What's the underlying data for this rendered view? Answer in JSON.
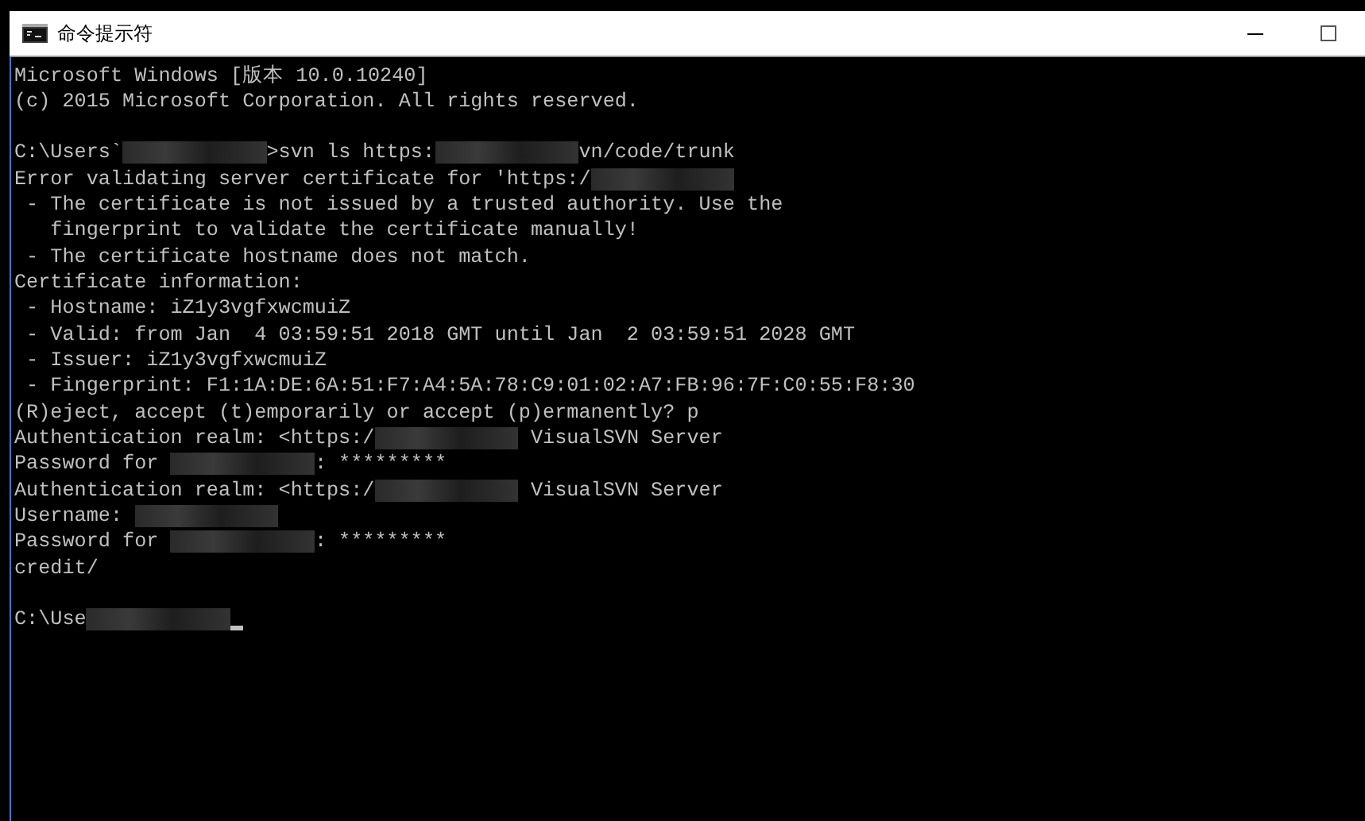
{
  "window": {
    "title": "命令提示符",
    "buttons": [
      {
        "kind": "minimize"
      },
      {
        "kind": "maximize"
      }
    ]
  },
  "console": {
    "lines": [
      [
        {
          "kind": "text",
          "text": "Microsoft Windows [版本 10.0.10240]"
        }
      ],
      [
        {
          "kind": "text",
          "text": "(c) 2015 Microsoft Corporation. All rights reserved."
        }
      ],
      [
        {
          "kind": "blank"
        }
      ],
      [
        {
          "kind": "text",
          "text": "C:\\Users`"
        },
        {
          "kind": "redaction"
        },
        {
          "kind": "text",
          "text": ">svn ls https:"
        },
        {
          "kind": "redaction"
        },
        {
          "kind": "text",
          "text": "vn/code/trunk"
        }
      ],
      [
        {
          "kind": "text",
          "text": "Error validating server certificate for 'https:/"
        },
        {
          "kind": "redaction"
        }
      ],
      [
        {
          "kind": "text",
          "text": " - The certificate is not issued by a trusted authority. Use the"
        }
      ],
      [
        {
          "kind": "text",
          "text": "   fingerprint to validate the certificate manually!"
        }
      ],
      [
        {
          "kind": "text",
          "text": " - The certificate hostname does not match."
        }
      ],
      [
        {
          "kind": "text",
          "text": "Certificate information:"
        }
      ],
      [
        {
          "kind": "text",
          "text": " - Hostname: iZ1y3vgfxwcmuiZ"
        }
      ],
      [
        {
          "kind": "text",
          "text": " - Valid: from Jan  4 03:59:51 2018 GMT until Jan  2 03:59:51 2028 GMT"
        }
      ],
      [
        {
          "kind": "text",
          "text": " - Issuer: iZ1y3vgfxwcmuiZ"
        }
      ],
      [
        {
          "kind": "text",
          "text": " - Fingerprint: F1:1A:DE:6A:51:F7:A4:5A:78:C9:01:02:A7:FB:96:7F:C0:55:F8:30"
        }
      ],
      [
        {
          "kind": "text",
          "text": "(R)eject, accept (t)emporarily or accept (p)ermanently? p"
        }
      ],
      [
        {
          "kind": "text",
          "text": "Authentication realm: <https:/"
        },
        {
          "kind": "redaction"
        },
        {
          "kind": "text",
          "text": " VisualSVN Server"
        }
      ],
      [
        {
          "kind": "text",
          "text": "Password for "
        },
        {
          "kind": "redaction"
        },
        {
          "kind": "text",
          "text": ": *********"
        }
      ],
      [
        {
          "kind": "text",
          "text": "Authentication realm: <https:/"
        },
        {
          "kind": "redaction"
        },
        {
          "kind": "text",
          "text": " VisualSVN Server"
        }
      ],
      [
        {
          "kind": "text",
          "text": "Username: "
        },
        {
          "kind": "redaction"
        }
      ],
      [
        {
          "kind": "text",
          "text": "Password for "
        },
        {
          "kind": "redaction"
        },
        {
          "kind": "text",
          "text": ": *********"
        }
      ],
      [
        {
          "kind": "text",
          "text": "credit/"
        }
      ],
      [
        {
          "kind": "blank"
        }
      ],
      [
        {
          "kind": "text",
          "text": "C:\\Use"
        },
        {
          "kind": "redaction"
        },
        {
          "kind": "cursor"
        }
      ]
    ]
  }
}
